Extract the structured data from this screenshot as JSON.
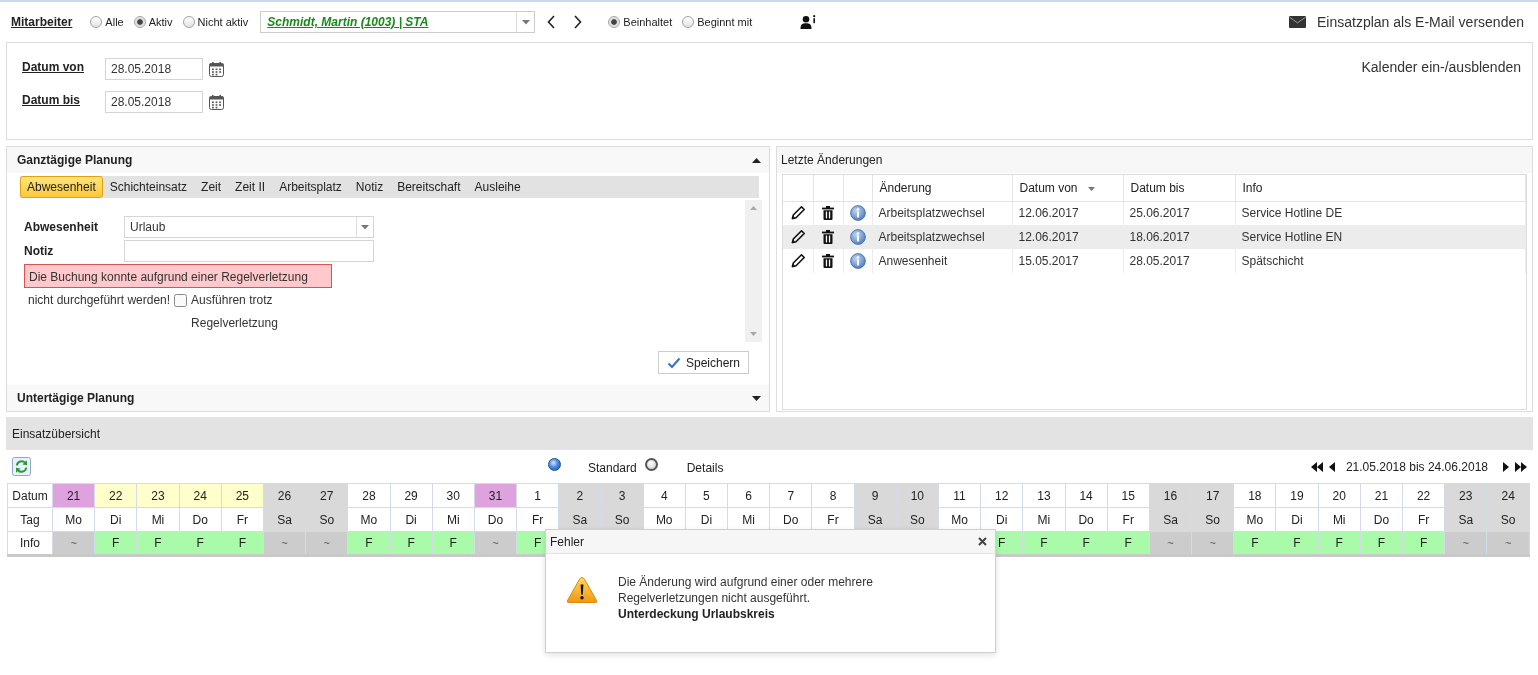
{
  "employee_bar": {
    "label": "Mitarbeiter",
    "filter_options": [
      {
        "label": "Alle",
        "selected": false
      },
      {
        "label": "Aktiv",
        "selected": true
      },
      {
        "label": "Nicht aktiv",
        "selected": false
      }
    ],
    "employee_select": {
      "value": "Schmidt, Martin (1003) | STA"
    },
    "match_options": [
      {
        "label": "Beinhaltet",
        "selected": true
      },
      {
        "label": "Beginnt mit",
        "selected": false
      }
    ],
    "email_link": "Einsatzplan als E-Mail versenden"
  },
  "date_range": {
    "fields": [
      {
        "label": "Datum von",
        "value": "28.05.2018"
      },
      {
        "label": "Datum bis",
        "value": "28.05.2018"
      }
    ],
    "calendar_toggle": "Kalender ein-/ausblenden"
  },
  "full_day_planning": {
    "title": "Ganztägige Planung",
    "expanded": true,
    "tabs": [
      {
        "label": "Abwesenheit",
        "selected": true
      },
      {
        "label": "Schichteinsatz",
        "selected": false
      },
      {
        "label": "Zeit",
        "selected": false
      },
      {
        "label": "Zeit II",
        "selected": false
      },
      {
        "label": "Arbeitsplatz",
        "selected": false
      },
      {
        "label": "Notiz",
        "selected": false
      },
      {
        "label": "Bereitschaft",
        "selected": false
      },
      {
        "label": "Ausleihe",
        "selected": false
      }
    ],
    "absence": {
      "label": "Abwesenheit",
      "value": "Urlaub"
    },
    "note": {
      "label": "Notiz"
    },
    "error": {
      "text": "Die Buchung konnte aufgrund einer Regelverletzung",
      "continuation": "nicht durchgeführt werden!"
    },
    "override": {
      "label": "Ausführen trotz Regelverletzung",
      "checked": false
    },
    "save_button": "Speichern"
  },
  "intraday_planning": {
    "title": "Untertägige Planung",
    "expanded": false
  },
  "recent_changes": {
    "title": "Letzte Änderungen",
    "columns": [
      {
        "label": "Änderung",
        "sorted": false
      },
      {
        "label": "Datum von",
        "sorted": true
      },
      {
        "label": "Datum bis",
        "sorted": false
      },
      {
        "label": "Info",
        "sorted": false
      }
    ],
    "rows": [
      {
        "change": "Arbeitsplatzwechsel",
        "date_from": "12.06.2017",
        "date_to": "25.06.2017",
        "info": "Service Hotline DE",
        "selected": false
      },
      {
        "change": "Arbeitsplatzwechsel",
        "date_from": "12.06.2017",
        "date_to": "18.06.2017",
        "info": "Service Hotline EN",
        "selected": true
      },
      {
        "change": "Anwesenheit",
        "date_from": "15.05.2017",
        "date_to": "28.05.2017",
        "info": "Spätschicht",
        "selected": false
      }
    ]
  },
  "overview": {
    "title": "Einsatzübersicht",
    "view_options": [
      {
        "label": "Standard",
        "selected": true
      },
      {
        "label": "Details",
        "selected": false
      }
    ],
    "range": "21.05.2018 bis 24.06.2018",
    "row_labels": [
      "Datum",
      "Tag",
      "Info"
    ],
    "days": [
      {
        "date": "21",
        "weekday": "Mo",
        "kind": "holiday",
        "info": {
          "text": "~",
          "kind": "off"
        }
      },
      {
        "date": "22",
        "weekday": "Di",
        "kind": "highlighted",
        "info": {
          "text": "F",
          "kind": "planned"
        }
      },
      {
        "date": "23",
        "weekday": "Mi",
        "kind": "highlighted",
        "info": {
          "text": "F",
          "kind": "planned"
        }
      },
      {
        "date": "24",
        "weekday": "Do",
        "kind": "highlighted",
        "info": {
          "text": "F",
          "kind": "planned"
        }
      },
      {
        "date": "25",
        "weekday": "Fr",
        "kind": "highlighted",
        "info": {
          "text": "F",
          "kind": "planned"
        }
      },
      {
        "date": "26",
        "weekday": "Sa",
        "kind": "weekend",
        "info": {
          "text": "~",
          "kind": "off"
        }
      },
      {
        "date": "27",
        "weekday": "So",
        "kind": "weekend",
        "info": {
          "text": "~",
          "kind": "off"
        }
      },
      {
        "date": "28",
        "weekday": "Mo",
        "kind": "workday",
        "info": {
          "text": "F",
          "kind": "planned"
        }
      },
      {
        "date": "29",
        "weekday": "Di",
        "kind": "workday",
        "info": {
          "text": "F",
          "kind": "planned"
        }
      },
      {
        "date": "30",
        "weekday": "Mi",
        "kind": "workday",
        "info": {
          "text": "F",
          "kind": "planned"
        }
      },
      {
        "date": "31",
        "weekday": "Do",
        "kind": "holiday",
        "info": {
          "text": "~",
          "kind": "off"
        }
      },
      {
        "date": "1",
        "weekday": "Fr",
        "kind": "workday",
        "info": {
          "text": "F",
          "kind": "planned"
        }
      },
      {
        "date": "2",
        "weekday": "Sa",
        "kind": "weekend"
      },
      {
        "date": "3",
        "weekday": "So",
        "kind": "weekend"
      },
      {
        "date": "4",
        "weekday": "Mo",
        "kind": "workday"
      },
      {
        "date": "5",
        "weekday": "Di",
        "kind": "workday"
      },
      {
        "date": "6",
        "weekday": "Mi",
        "kind": "workday"
      },
      {
        "date": "7",
        "weekday": "Do",
        "kind": "workday"
      },
      {
        "date": "8",
        "weekday": "Fr",
        "kind": "workday"
      },
      {
        "date": "9",
        "weekday": "Sa",
        "kind": "weekend"
      },
      {
        "date": "10",
        "weekday": "So",
        "kind": "weekend"
      },
      {
        "date": "11",
        "weekday": "Mo",
        "kind": "workday"
      },
      {
        "date": "12",
        "weekday": "Di",
        "kind": "workday",
        "info": {
          "text": "F",
          "kind": "planned"
        }
      },
      {
        "date": "13",
        "weekday": "Mi",
        "kind": "workday",
        "info": {
          "text": "F",
          "kind": "planned"
        }
      },
      {
        "date": "14",
        "weekday": "Do",
        "kind": "workday",
        "info": {
          "text": "F",
          "kind": "planned"
        }
      },
      {
        "date": "15",
        "weekday": "Fr",
        "kind": "workday",
        "info": {
          "text": "F",
          "kind": "planned"
        }
      },
      {
        "date": "16",
        "weekday": "Sa",
        "kind": "weekend",
        "info": {
          "text": "~",
          "kind": "off"
        }
      },
      {
        "date": "17",
        "weekday": "So",
        "kind": "weekend",
        "info": {
          "text": "~",
          "kind": "off"
        }
      },
      {
        "date": "18",
        "weekday": "Mo",
        "kind": "workday",
        "info": {
          "text": "F",
          "kind": "planned"
        }
      },
      {
        "date": "19",
        "weekday": "Di",
        "kind": "workday",
        "info": {
          "text": "F",
          "kind": "planned"
        }
      },
      {
        "date": "20",
        "weekday": "Mi",
        "kind": "workday",
        "info": {
          "text": "F",
          "kind": "planned"
        }
      },
      {
        "date": "21",
        "weekday": "Do",
        "kind": "workday",
        "info": {
          "text": "F",
          "kind": "planned"
        }
      },
      {
        "date": "22",
        "weekday": "Fr",
        "kind": "workday",
        "info": {
          "text": "F",
          "kind": "planned"
        }
      },
      {
        "date": "23",
        "weekday": "Sa",
        "kind": "weekend",
        "info": {
          "text": "~",
          "kind": "off"
        }
      },
      {
        "date": "24",
        "weekday": "So",
        "kind": "weekend",
        "info": {
          "text": "~",
          "kind": "off"
        }
      }
    ]
  },
  "error_dialog": {
    "title": "Fehler",
    "message": "Die Änderung wird aufgrund einer oder mehrere Regelverletzungen nicht ausgeführt.",
    "detail": "Unterdeckung Urlaubskreis"
  }
}
